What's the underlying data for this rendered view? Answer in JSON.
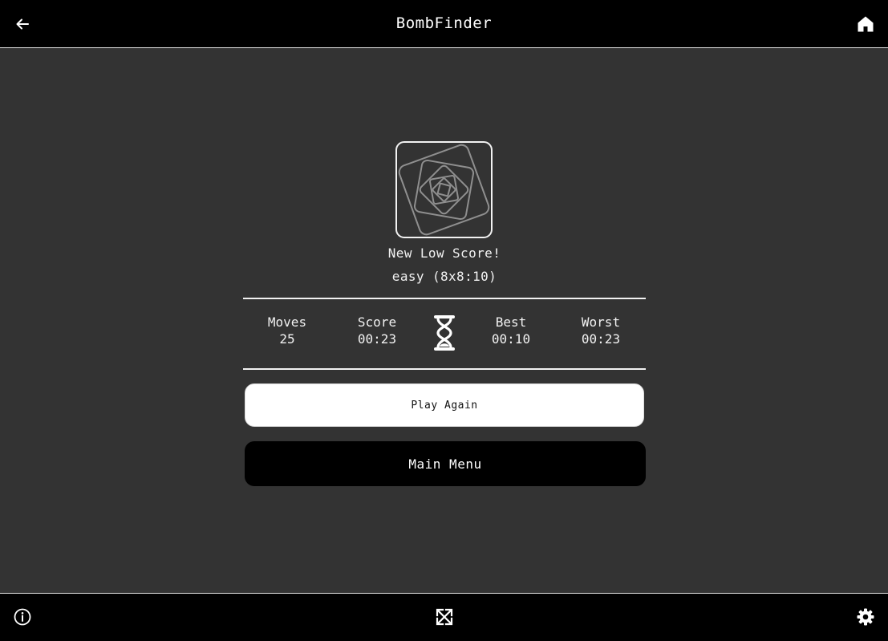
{
  "header": {
    "title": "BombFinder",
    "back_icon": "arrow-left-icon",
    "home_icon": "home-icon"
  },
  "result": {
    "badge_icon": "spiral-squares-icon",
    "headline": "New Low Score!",
    "difficulty": "easy (8x8:10)"
  },
  "stats": {
    "moves_label": "Moves",
    "moves_value": "25",
    "score_label": "Score",
    "score_value": "00:23",
    "timer_icon": "hourglass-icon",
    "best_label": "Best",
    "best_value": "00:10",
    "worst_label": "Worst",
    "worst_value": "00:23"
  },
  "actions": {
    "play_again": "Play Again",
    "main_menu": "Main Menu"
  },
  "footer": {
    "info_icon": "info-icon",
    "fullscreen_icon": "fullscreen-icon",
    "settings_icon": "gear-icon"
  },
  "colors": {
    "background": "#333333",
    "bar": "#000000",
    "foreground": "#f2f2f2"
  }
}
